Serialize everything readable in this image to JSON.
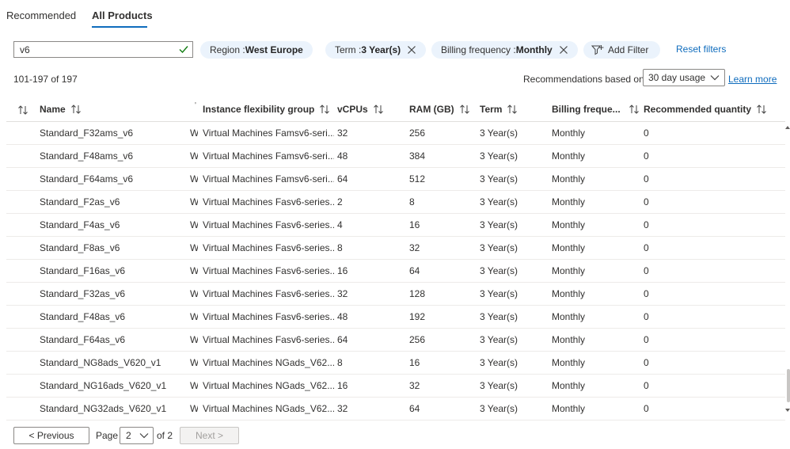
{
  "tabs": [
    {
      "label": "Recommended"
    },
    {
      "label": "All Products"
    }
  ],
  "search": {
    "value": "v6"
  },
  "filters": [
    {
      "key": "Region : ",
      "value": "West Europe",
      "removable": false
    },
    {
      "key": "Term : ",
      "value": "3 Year(s)",
      "removable": true
    },
    {
      "key": "Billing frequency : ",
      "value": "Monthly",
      "removable": true
    }
  ],
  "add_filter_label": "Add Filter",
  "reset_filters_label": "Reset filters",
  "result_count": "101-197 of 197",
  "recommendations": {
    "label": "Recommendations based on",
    "selected": "30 day usage",
    "learn_more": "Learn more"
  },
  "table": {
    "columns": [
      "Name",
      "Instance flexibility group",
      "vCPUs",
      "RAM (GB)",
      "Term",
      "Billing freque...",
      "Recommended quantity"
    ],
    "rows": [
      {
        "name": "Standard_F32ams_v6",
        "trunc": "W",
        "group": "Virtual Machines Famsv6-seri...",
        "vcpus": "32",
        "ram": "256",
        "term": "3 Year(s)",
        "billing": "Monthly",
        "qty": "0"
      },
      {
        "name": "Standard_F48ams_v6",
        "trunc": "W",
        "group": "Virtual Machines Famsv6-seri...",
        "vcpus": "48",
        "ram": "384",
        "term": "3 Year(s)",
        "billing": "Monthly",
        "qty": "0"
      },
      {
        "name": "Standard_F64ams_v6",
        "trunc": "W",
        "group": "Virtual Machines Famsv6-seri...",
        "vcpus": "64",
        "ram": "512",
        "term": "3 Year(s)",
        "billing": "Monthly",
        "qty": "0"
      },
      {
        "name": "Standard_F2as_v6",
        "trunc": "W",
        "group": "Virtual Machines Fasv6-series...",
        "vcpus": "2",
        "ram": "8",
        "term": "3 Year(s)",
        "billing": "Monthly",
        "qty": "0"
      },
      {
        "name": "Standard_F4as_v6",
        "trunc": "W",
        "group": "Virtual Machines Fasv6-series...",
        "vcpus": "4",
        "ram": "16",
        "term": "3 Year(s)",
        "billing": "Monthly",
        "qty": "0"
      },
      {
        "name": "Standard_F8as_v6",
        "trunc": "W",
        "group": "Virtual Machines Fasv6-series...",
        "vcpus": "8",
        "ram": "32",
        "term": "3 Year(s)",
        "billing": "Monthly",
        "qty": "0"
      },
      {
        "name": "Standard_F16as_v6",
        "trunc": "W",
        "group": "Virtual Machines Fasv6-series...",
        "vcpus": "16",
        "ram": "64",
        "term": "3 Year(s)",
        "billing": "Monthly",
        "qty": "0"
      },
      {
        "name": "Standard_F32as_v6",
        "trunc": "W",
        "group": "Virtual Machines Fasv6-series...",
        "vcpus": "32",
        "ram": "128",
        "term": "3 Year(s)",
        "billing": "Monthly",
        "qty": "0"
      },
      {
        "name": "Standard_F48as_v6",
        "trunc": "W",
        "group": "Virtual Machines Fasv6-series...",
        "vcpus": "48",
        "ram": "192",
        "term": "3 Year(s)",
        "billing": "Monthly",
        "qty": "0"
      },
      {
        "name": "Standard_F64as_v6",
        "trunc": "W",
        "group": "Virtual Machines Fasv6-series...",
        "vcpus": "64",
        "ram": "256",
        "term": "3 Year(s)",
        "billing": "Monthly",
        "qty": "0"
      },
      {
        "name": "Standard_NG8ads_V620_v1",
        "trunc": "W",
        "group": "Virtual Machines NGads_V62...",
        "vcpus": "8",
        "ram": "16",
        "term": "3 Year(s)",
        "billing": "Monthly",
        "qty": "0"
      },
      {
        "name": "Standard_NG16ads_V620_v1",
        "trunc": "W",
        "group": "Virtual Machines NGads_V62...",
        "vcpus": "16",
        "ram": "32",
        "term": "3 Year(s)",
        "billing": "Monthly",
        "qty": "0"
      },
      {
        "name": "Standard_NG32ads_V620_v1",
        "trunc": "W",
        "group": "Virtual Machines NGads_V62...",
        "vcpus": "32",
        "ram": "64",
        "term": "3 Year(s)",
        "billing": "Monthly",
        "qty": "0"
      }
    ]
  },
  "pagination": {
    "previous": "< Previous",
    "page_label": "Page",
    "current_page": "2",
    "of_label": "of 2",
    "next": "Next >"
  },
  "colors": {
    "accent": "#0f6cbd",
    "pill_bg": "#ebf3fc",
    "success": "#107c10"
  },
  "icons": [
    "check-icon",
    "dismiss-icon",
    "add-filter-icon",
    "chevron-down-icon",
    "sort-icon"
  ]
}
